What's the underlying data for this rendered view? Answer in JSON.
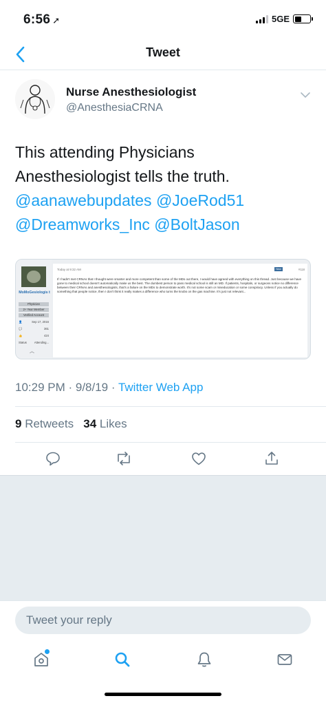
{
  "status_bar": {
    "time": "6:56",
    "network": "5GE"
  },
  "nav": {
    "title": "Tweet"
  },
  "author": {
    "name": "Nurse Anesthesiologist",
    "handle": "@AnesthesiaCRNA"
  },
  "tweet": {
    "text_line1": "This attending Physicians",
    "text_line2": "Anesthesiologist tells the truth.",
    "mentions_line1": "@aanawebupdates @JoeRod51",
    "mentions_line2": "@Dreamworks_Inc @BoltJason"
  },
  "media": {
    "username": "MoMoGesiologis t",
    "badges": [
      "Physician",
      "2+ Year Member",
      "Verified Account"
    ],
    "stats": [
      {
        "icon": "person-icon",
        "value": "Sep 17, 2016"
      },
      {
        "icon": "messages-icon",
        "value": "361"
      },
      {
        "icon": "thumb-icon",
        "value": "424"
      },
      {
        "label": "Status",
        "value": "Attending..."
      }
    ],
    "post_time": "Today at 9:32 AM",
    "post_badge": "New",
    "post_number": "#118",
    "post_body": "If I hadn't met CRNAs that I thought were smarter and more competent than some of the MDs out there, I would have agreed with everything on this thread. Just because we have gone to medical school doesn't automatically make us the best. The dumbest person to pass medical school is still an MD. If patients, hospitals, or surgeons notice no difference between their CRNAs and anesthesiologists, that's a failure on the MDs to demonstrate worth. It's not some scam or miseducation or some conspiracy. Unless if you actually do something that people notice, then I don't think it really makes a difference who turns the knobs on the gas machine. It's just not relevant..."
  },
  "meta": {
    "time": "10:29 PM · 9/8/19 · ",
    "app": "Twitter Web App"
  },
  "stats": {
    "retweets_count": "9",
    "retweets_label": "Retweets",
    "likes_count": "34",
    "likes_label": "Likes"
  },
  "reply": {
    "placeholder": "Tweet your reply"
  },
  "icons": {
    "reply": "reply-icon",
    "retweet": "retweet-icon",
    "like": "heart-icon",
    "share": "share-icon",
    "home": "home-icon",
    "search": "search-icon",
    "notifications": "bell-icon",
    "messages": "mail-icon"
  },
  "colors": {
    "accent": "#1da1f2",
    "secondary_text": "#657786",
    "divider": "#e1e8ed",
    "background_gray": "#e6ecf0"
  }
}
